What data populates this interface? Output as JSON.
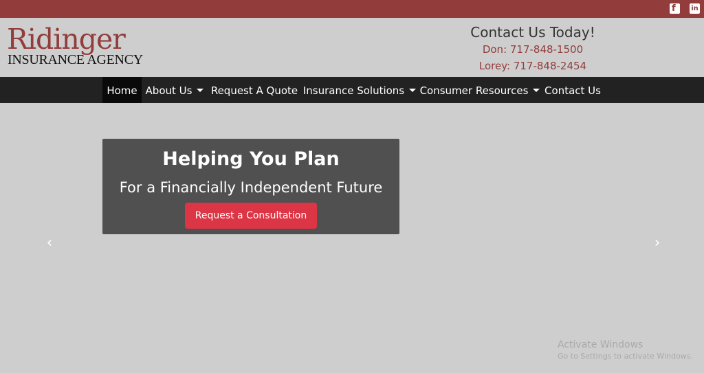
{
  "social": {
    "facebook_icon": "facebook-square",
    "linkedin_icon": "linkedin-square",
    "facebook_glyph": "f",
    "linkedin_glyph": "in"
  },
  "logo": {
    "name_line": "Ridinger",
    "agency_line": "INSURANCE AGENCY"
  },
  "contact": {
    "title": "Contact Us Today!",
    "phone_1": "Don: 717-848-1500",
    "phone_2": "Lorey: 717-848-2454"
  },
  "nav": {
    "items": [
      {
        "label": "Home",
        "active": true,
        "dropdown": false
      },
      {
        "label": "About Us",
        "active": false,
        "dropdown": true
      },
      {
        "label": "Request A Quote",
        "active": false,
        "dropdown": false
      },
      {
        "label": "Insurance Solutions",
        "active": false,
        "dropdown": true
      },
      {
        "label": "Consumer Resources",
        "active": false,
        "dropdown": true
      },
      {
        "label": "Contact Us",
        "active": false,
        "dropdown": false
      }
    ]
  },
  "hero": {
    "title": "Helping You Plan",
    "subtitle": "For a Financially Independent Future",
    "cta_label": "Request a Consultation"
  },
  "carousel": {
    "prev_glyph": "‹",
    "next_glyph": "›"
  },
  "watermark": {
    "line_1": "Activate Windows",
    "line_2": "Go to Settings to activate Windows."
  },
  "colors": {
    "brand_red": "#923c3c",
    "navbar_bg": "#222222",
    "page_bg": "#cecece",
    "hero_bg": "#505050",
    "cta_bg": "#dc3545"
  }
}
